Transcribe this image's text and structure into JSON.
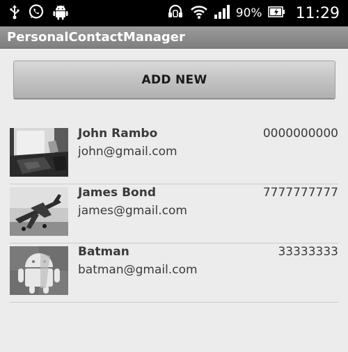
{
  "status_bar": {
    "icons_left": [
      "usb-icon",
      "whatsapp-icon",
      "android-icon"
    ],
    "icons_right": [
      "headset-icon",
      "wifi-icon",
      "signal-icon",
      "battery-icon"
    ],
    "battery": "90%",
    "time": "11:29"
  },
  "app": {
    "title": "PersonalContactManager"
  },
  "actions": {
    "add_new_label": "ADD NEW"
  },
  "contacts": [
    {
      "name": "John Rambo",
      "email": "john@gmail.com",
      "phone": "0000000000",
      "thumbnail": "room-photo"
    },
    {
      "name": "James Bond",
      "email": "james@gmail.com",
      "phone": "7777777777",
      "thumbnail": "airplane-photo"
    },
    {
      "name": "Batman",
      "email": "batman@gmail.com",
      "phone": "33333333",
      "thumbnail": "android-robot-image"
    }
  ],
  "colors": {
    "status_bar": "#000000",
    "title_bar": "#8a8a8a",
    "background": "#ececec",
    "text": "#3a3a3a",
    "divider": "#c9c9c9"
  }
}
